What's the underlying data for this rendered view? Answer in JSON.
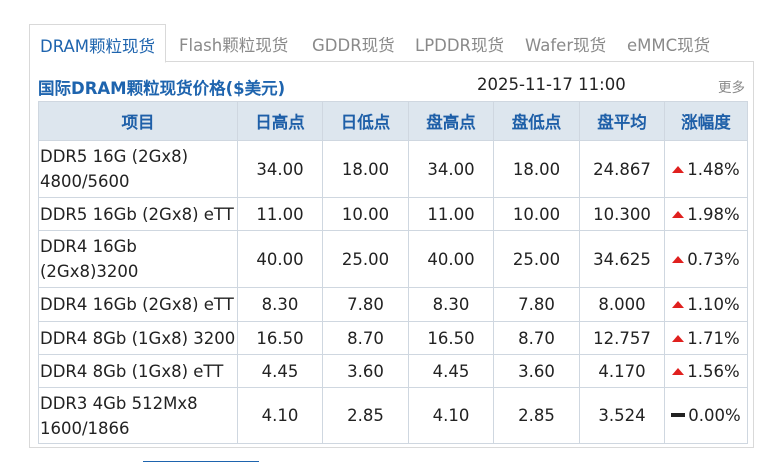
{
  "tabs": [
    "DRAM颗粒现货",
    "Flash颗粒现货",
    "GDDR现货",
    "LPDDR现货",
    "Wafer现货",
    "eMMC现货"
  ],
  "panel": {
    "title": "国际DRAM颗粒现货价格($美元)",
    "timestamp": "2025-11-17 11:00",
    "more": "更多"
  },
  "table": {
    "headers": [
      "项目",
      "日高点",
      "日低点",
      "盘高点",
      "盘低点",
      "盘平均",
      "涨幅度"
    ],
    "rows": [
      {
        "item": "DDR5 16G (2Gx8) 4800/5600",
        "day_high": "34.00",
        "day_low": "18.00",
        "session_high": "34.00",
        "session_low": "18.00",
        "session_avg": "24.867",
        "change": "1.48%",
        "direction": "up"
      },
      {
        "item": "DDR5 16Gb (2Gx8) eTT",
        "day_high": "11.00",
        "day_low": "10.00",
        "session_high": "11.00",
        "session_low": "10.00",
        "session_avg": "10.300",
        "change": "1.98%",
        "direction": "up"
      },
      {
        "item": "DDR4 16Gb (2Gx8)3200",
        "day_high": "40.00",
        "day_low": "25.00",
        "session_high": "40.00",
        "session_low": "25.00",
        "session_avg": "34.625",
        "change": "0.73%",
        "direction": "up"
      },
      {
        "item": "DDR4 16Gb (2Gx8) eTT",
        "day_high": "8.30",
        "day_low": "7.80",
        "session_high": "8.30",
        "session_low": "7.80",
        "session_avg": "8.000",
        "change": "1.10%",
        "direction": "up"
      },
      {
        "item": "DDR4 8Gb (1Gx8) 3200",
        "day_high": "16.50",
        "day_low": "8.70",
        "session_high": "16.50",
        "session_low": "8.70",
        "session_avg": "12.757",
        "change": "1.71%",
        "direction": "up"
      },
      {
        "item": "DDR4 8Gb (1Gx8) eTT",
        "day_high": "4.45",
        "day_low": "3.60",
        "session_high": "4.45",
        "session_low": "3.60",
        "session_avg": "4.170",
        "change": "1.56%",
        "direction": "up"
      },
      {
        "item": "DDR3 4Gb 512Mx8 1600/1866",
        "day_high": "4.10",
        "day_low": "2.85",
        "session_high": "4.10",
        "session_low": "2.85",
        "session_avg": "3.524",
        "change": "0.00%",
        "direction": "flat"
      }
    ]
  },
  "colors": {
    "accent": "#1e64ae",
    "header_bg": "#dde6ee",
    "up": "#e0201e",
    "flat": "#222222"
  },
  "icons": {
    "up": "red-up-triangle-icon",
    "flat": "flat-dash-icon"
  }
}
